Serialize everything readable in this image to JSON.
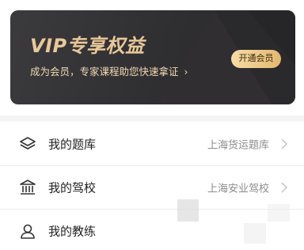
{
  "vip": {
    "title": "VIP专享权益",
    "subtitle": "成为会员，专家课程助您快速拿证",
    "subtitle_arrow": "›",
    "button_label": "开通会员",
    "colors": {
      "card": "#2f2e31",
      "title": "#e9c898",
      "button": "#efc983"
    }
  },
  "list": {
    "items": [
      {
        "label": "我的题库",
        "value": "上海货运题库",
        "icon": "layers-icon"
      },
      {
        "label": "我的驾校",
        "value": "上海安业驾校",
        "icon": "school-building-icon"
      },
      {
        "label": "我的教练",
        "value": "",
        "icon": "person-icon"
      }
    ]
  }
}
